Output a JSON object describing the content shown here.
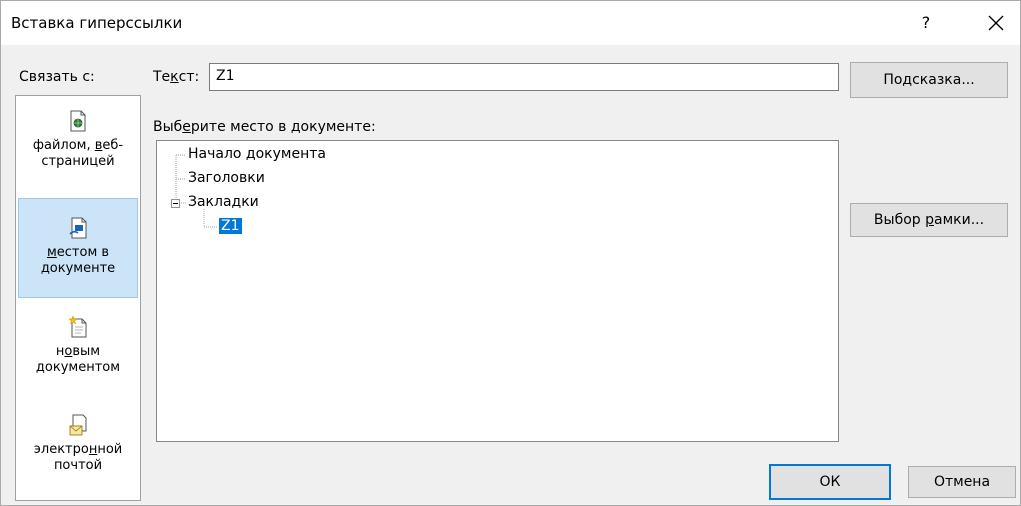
{
  "window": {
    "title": "Вставка гиперссылки",
    "help": "?"
  },
  "link_to": {
    "label": "Связать с:",
    "items": [
      {
        "label_before": "файлом, ",
        "label_u": "в",
        "label_after": "еб-страницей",
        "icon": "web-page-file-icon"
      },
      {
        "label_before": "",
        "label_u": "м",
        "label_after": "естом в документе",
        "icon": "place-in-document-icon",
        "selected": true
      },
      {
        "label_before": "н",
        "label_u": "о",
        "label_after": "вым документом",
        "icon": "new-document-icon"
      },
      {
        "label_before": "электро",
        "label_u": "н",
        "label_after": "ной почтой",
        "icon": "email-address-icon"
      }
    ]
  },
  "text_field": {
    "label_before": "Те",
    "label_u": "к",
    "label_after": "ст:",
    "value": "Z1"
  },
  "hint_button": {
    "label_before": "По",
    "label_u": "д",
    "label_after": "сказка..."
  },
  "place": {
    "label_before": "Выб",
    "label_u": "е",
    "label_after": "рите место в документе:",
    "tree": [
      "Начало документа",
      "Заголовки",
      "Закладки",
      "Z1"
    ]
  },
  "frame_button": {
    "label_before": "Выбор ",
    "label_u": "р",
    "label_after": "амки..."
  },
  "ok_button": "ОК",
  "cancel_button": "Отмена"
}
